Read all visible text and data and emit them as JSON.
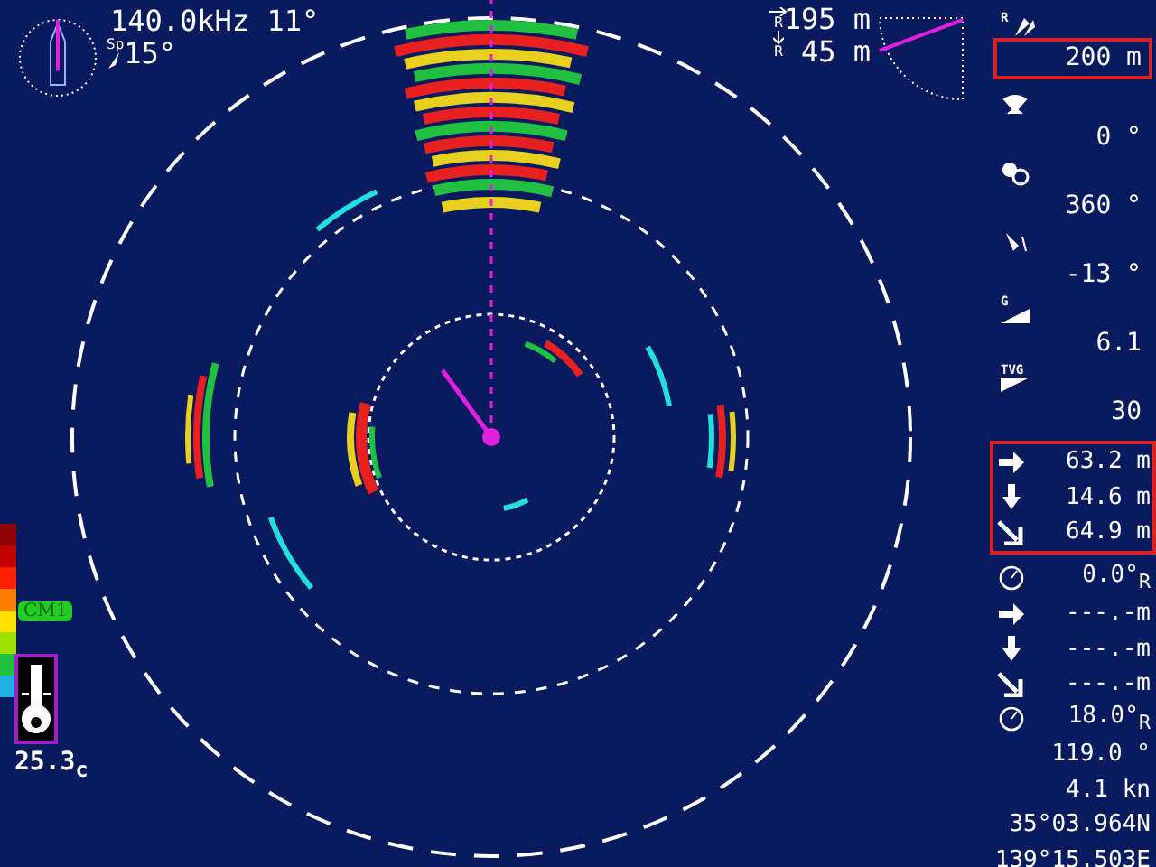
{
  "header": {
    "frequency": "140.0kHz",
    "tilt": "11°",
    "speed_label": "Sp",
    "speed_value": "15°"
  },
  "target_info": {
    "horizontal_marker": "R",
    "horizontal": "195 m",
    "depth_marker": "R",
    "depth": "45 m"
  },
  "left_scale": {
    "badge": "CM1",
    "temperature": "25.3$_{c}$"
  },
  "panel": [
    {
      "boxed": false,
      "rows": [
        {
          "kind": "range",
          "icon_text": "R",
          "value": "200 m",
          "boxed": true
        }
      ]
    },
    {
      "boxed": false,
      "rows": [
        {
          "kind": "bearing",
          "value": "0 °"
        },
        {
          "kind": "sector",
          "value": "360 °"
        },
        {
          "kind": "tilt",
          "value": "-13 °"
        },
        {
          "kind": "gain",
          "icon_text": "G",
          "value": "6.1"
        },
        {
          "kind": "tvg",
          "icon_text": "TVG",
          "value": "30"
        }
      ]
    },
    {
      "boxed": true,
      "rows": [
        {
          "kind": "right",
          "value": "63.2 m"
        },
        {
          "kind": "down",
          "value": "14.6 m"
        },
        {
          "kind": "diagonal",
          "value": "64.9 m"
        }
      ]
    },
    {
      "boxed": false,
      "rows": [
        {
          "kind": "clock",
          "value": "0.0°$_{R}$"
        },
        {
          "kind": "right",
          "value": "---.-m"
        },
        {
          "kind": "down",
          "value": "---.-m"
        },
        {
          "kind": "diagonal",
          "value": "---.-m"
        },
        {
          "kind": "clock",
          "value": "18.0°$_{R}$"
        },
        {
          "kind": "text",
          "value": "119.0 °"
        },
        {
          "kind": "text",
          "value": "4.1 kn"
        },
        {
          "kind": "text",
          "value": "35°03.964N"
        },
        {
          "kind": "text",
          "value": "139°15.503E"
        }
      ]
    }
  ]
}
